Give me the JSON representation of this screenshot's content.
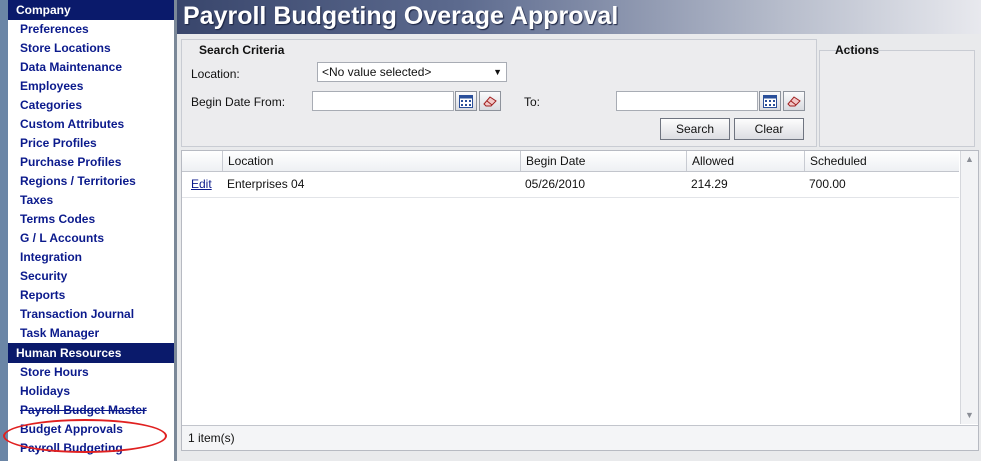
{
  "sidebar": {
    "company_header": "Company",
    "company_items": [
      "Preferences",
      "Store Locations",
      "Data Maintenance",
      "Employees",
      "Categories",
      "Custom Attributes",
      "Price Profiles",
      "Purchase Profiles",
      "Regions / Territories",
      "Taxes",
      "Terms Codes",
      "G / L Accounts",
      "Integration",
      "Security",
      "Reports",
      "Transaction Journal",
      "Task Manager"
    ],
    "hr_header": "Human Resources",
    "hr_items": [
      "Store Hours",
      "Holidays",
      "Payroll Budget Master",
      "Budget Approvals",
      "Payroll Budgeting"
    ],
    "highlight_color": "#e02020"
  },
  "page": {
    "title": "Payroll Budgeting Overage Approval"
  },
  "search": {
    "title": "Search Criteria",
    "location_label": "Location:",
    "location_value": "<No value selected>",
    "begin_from_label": "Begin Date From:",
    "begin_from_value": "",
    "to_label": "To:",
    "to_value": "",
    "search_label": "Search",
    "clear_label": "Clear"
  },
  "actions": {
    "title": "Actions"
  },
  "grid": {
    "columns": [
      "Location",
      "Begin Date",
      "Allowed",
      "Scheduled"
    ],
    "rows": [
      {
        "action": "Edit",
        "location": "Enterprises 04",
        "begin_date": "05/26/2010",
        "allowed": "214.29",
        "scheduled": "700.00"
      }
    ],
    "footer": "1 item(s)"
  },
  "colors": {
    "nav_header": "#0a1a6b",
    "nav_link": "#0b1a8c",
    "title_gradient_start": "#39466c"
  }
}
